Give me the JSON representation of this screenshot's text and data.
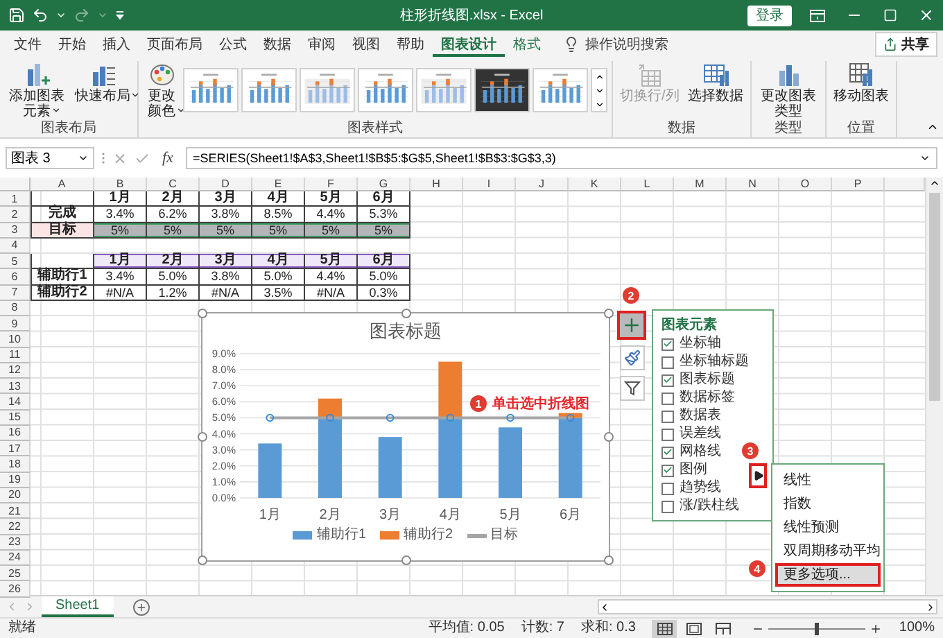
{
  "window": {
    "title": "柱形折线图.xlsx - Excel",
    "sign_in": "登录"
  },
  "ribbon_tabs": [
    {
      "label": "文件",
      "selected": false,
      "contextual": false
    },
    {
      "label": "开始",
      "selected": false,
      "contextual": false
    },
    {
      "label": "插入",
      "selected": false,
      "contextual": false
    },
    {
      "label": "页面布局",
      "selected": false,
      "contextual": false
    },
    {
      "label": "公式",
      "selected": false,
      "contextual": false
    },
    {
      "label": "数据",
      "selected": false,
      "contextual": false
    },
    {
      "label": "审阅",
      "selected": false,
      "contextual": false
    },
    {
      "label": "视图",
      "selected": false,
      "contextual": false
    },
    {
      "label": "帮助",
      "selected": false,
      "contextual": false
    },
    {
      "label": "图表设计",
      "selected": true,
      "contextual": true
    },
    {
      "label": "格式",
      "selected": false,
      "contextual": true
    }
  ],
  "tell_me": "操作说明搜索",
  "share": "共享",
  "ribbon_groups": [
    {
      "label": "图表布局",
      "buttons": [
        {
          "kind": "add_element",
          "label": "添加图表元素",
          "dropdown": true,
          "disabled": false
        },
        {
          "kind": "quick_layout",
          "label": "快速布局",
          "dropdown": true,
          "disabled": false
        }
      ]
    },
    {
      "label": "图表样式",
      "buttons": [
        {
          "kind": "colors",
          "label": "更改颜色",
          "dropdown": true,
          "disabled": false
        }
      ],
      "styles": [
        {
          "kind": "plain"
        },
        {
          "kind": "plain"
        },
        {
          "kind": "shaded"
        },
        {
          "kind": "plain"
        },
        {
          "kind": "shaded"
        },
        {
          "kind": "dark"
        },
        {
          "kind": "plain"
        }
      ]
    },
    {
      "label": "数据",
      "buttons": [
        {
          "kind": "switch",
          "label": "切换行/列",
          "dropdown": false,
          "disabled": true
        },
        {
          "kind": "select_data",
          "label": "选择数据",
          "dropdown": false,
          "disabled": false
        }
      ]
    },
    {
      "label": "类型",
      "buttons": [
        {
          "kind": "change_type",
          "label": "更改图表类型",
          "dropdown": false,
          "disabled": false
        }
      ]
    },
    {
      "label": "位置",
      "buttons": [
        {
          "kind": "move",
          "label": "移动图表",
          "dropdown": false,
          "disabled": false
        }
      ]
    }
  ],
  "formula_bar": {
    "name_box": "图表 3",
    "function_label": "fx",
    "formula": "=SERIES(Sheet1!$A$3,Sheet1!$B$5:$G$5,Sheet1!$B$3:$G$3,3)"
  },
  "sheet": {
    "columns": [
      "A",
      "B",
      "C",
      "D",
      "E",
      "F",
      "G",
      "H",
      "I",
      "J",
      "K",
      "L",
      "M",
      "N",
      "O",
      "P"
    ],
    "row_headers": [
      "1",
      "2",
      "3",
      "4",
      "5",
      "6",
      "7",
      "8",
      "9",
      "10",
      "11",
      "12",
      "13",
      "14",
      "15",
      "16",
      "17",
      "18",
      "19",
      "20",
      "21",
      "22",
      "23",
      "24",
      "25",
      "26"
    ],
    "rows": [
      {
        "kind": "header",
        "selected": false,
        "referenced": false,
        "cells": [
          null,
          "1月",
          "2月",
          "3月",
          "4月",
          "5月",
          "6月"
        ]
      },
      {
        "kind": "data",
        "selected": false,
        "referenced": false,
        "cells": [
          "完成",
          "3.4%",
          "6.2%",
          "3.8%",
          "8.5%",
          "4.4%",
          "5.3%"
        ]
      },
      {
        "kind": "data",
        "selected": true,
        "referenced": false,
        "cells": [
          "目标",
          "5%",
          "5%",
          "5%",
          "5%",
          "5%",
          "5%"
        ]
      },
      {
        "kind": "blank"
      },
      {
        "kind": "header",
        "selected": false,
        "referenced": true,
        "cells": [
          null,
          "1月",
          "2月",
          "3月",
          "4月",
          "5月",
          "6月"
        ]
      },
      {
        "kind": "data",
        "selected": false,
        "referenced": false,
        "cells": [
          "辅助行1",
          "3.4%",
          "5.0%",
          "3.8%",
          "5.0%",
          "4.4%",
          "5.0%"
        ]
      },
      {
        "kind": "data",
        "selected": false,
        "referenced": false,
        "cells": [
          "辅助行2",
          "#N/A",
          "1.2%",
          "#N/A",
          "3.5%",
          "#N/A",
          "0.3%"
        ]
      }
    ]
  },
  "chart": {
    "chart_data": {
      "type": "bar",
      "title": "图表标题",
      "stacked": true,
      "grid": true,
      "legend": "bottom",
      "categories": [
        "1月",
        "2月",
        "3月",
        "4月",
        "5月",
        "6月"
      ],
      "series": [
        {
          "name": "辅助行1",
          "color": "#5b9bd5",
          "type": "bar",
          "values": [
            3.4,
            5.0,
            3.8,
            5.0,
            4.4,
            5.0
          ]
        },
        {
          "name": "辅助行2",
          "color": "#ed7d31",
          "type": "bar",
          "values": [
            null,
            1.2,
            null,
            3.5,
            null,
            0.3
          ]
        },
        {
          "name": "目标",
          "color": "#a5a5a5",
          "type": "line",
          "marker": "circle",
          "values": [
            5,
            5,
            5,
            5,
            5,
            5
          ]
        }
      ],
      "ylim": [
        0,
        9
      ],
      "yticks": [
        {
          "value": 0,
          "label": "0.0%"
        },
        {
          "value": 1,
          "label": "1.0%"
        },
        {
          "value": 2,
          "label": "2.0%"
        },
        {
          "value": 3,
          "label": "3.0%"
        },
        {
          "value": 4,
          "label": "4.0%"
        },
        {
          "value": 5,
          "label": "5.0%"
        },
        {
          "value": 6,
          "label": "6.0%"
        },
        {
          "value": 7,
          "label": "7.0%"
        },
        {
          "value": 8,
          "label": "8.0%"
        },
        {
          "value": 9,
          "label": "9.0%"
        }
      ]
    },
    "tools": [
      {
        "kind": "elements",
        "selected": true,
        "outlined": true
      },
      {
        "kind": "styles",
        "selected": false,
        "outlined": false
      },
      {
        "kind": "filters",
        "selected": false,
        "outlined": false
      }
    ],
    "elements_panel": {
      "title": "图表元素",
      "items": [
        {
          "label": "坐标轴",
          "checked": true
        },
        {
          "label": "坐标轴标题",
          "checked": false
        },
        {
          "label": "图表标题",
          "checked": true
        },
        {
          "label": "数据标签",
          "checked": false
        },
        {
          "label": "数据表",
          "checked": false
        },
        {
          "label": "误差线",
          "checked": false
        },
        {
          "label": "网格线",
          "checked": true
        },
        {
          "label": "图例",
          "checked": true
        },
        {
          "label": "趋势线",
          "checked": false
        },
        {
          "label": "涨/跌柱线",
          "checked": false
        }
      ]
    },
    "trend_menu_button": {
      "outlined": true
    },
    "trendline_menu": {
      "items": [
        {
          "label": "线性",
          "selected": false,
          "outlined": false
        },
        {
          "label": "指数",
          "selected": false,
          "outlined": false
        },
        {
          "label": "线性预测",
          "selected": false,
          "outlined": false
        },
        {
          "label": "双周期移动平均",
          "selected": false,
          "outlined": false
        },
        {
          "label": "更多选项...",
          "selected": true,
          "outlined": true
        }
      ]
    }
  },
  "annotations": [
    {
      "number": "1",
      "text": "单击选中折线图"
    },
    {
      "number": "2"
    },
    {
      "number": "3"
    },
    {
      "number": "4"
    }
  ],
  "sheet_tabs": [
    {
      "label": "Sheet1",
      "selected": true
    }
  ],
  "status_bar": {
    "ready": "就绪",
    "average": "平均值: 0.05",
    "count": "计数: 7",
    "sum": "求和: 0.3",
    "views": [
      {
        "kind": "normal",
        "selected": true
      },
      {
        "kind": "page_layout",
        "selected": false
      },
      {
        "kind": "page_break",
        "selected": false
      }
    ],
    "zoom": {
      "level": 0.5,
      "reading": "100%"
    }
  }
}
